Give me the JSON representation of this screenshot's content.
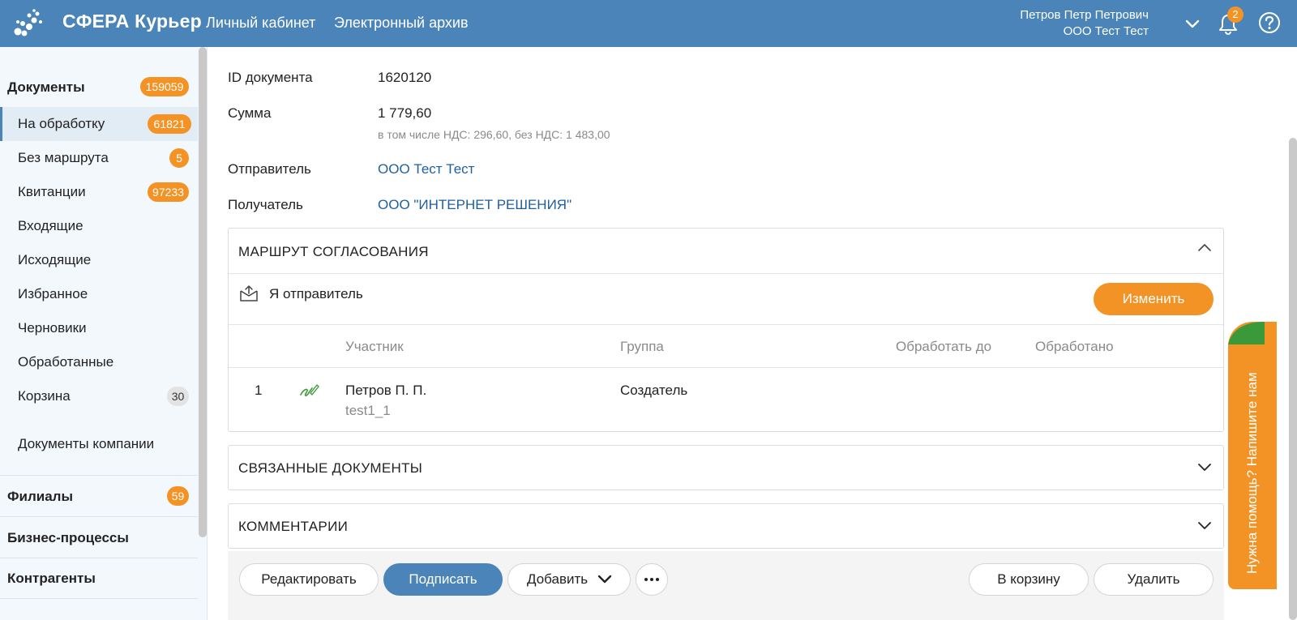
{
  "header": {
    "brand": "СФЕРА Курьер",
    "nav": [
      "Личный кабинет",
      "Электронный архив"
    ],
    "user_name": "Петров Петр Петрович",
    "user_org": "ООО Тест Тест",
    "notifications": "2",
    "bg_color": "#4a84b8"
  },
  "sidebar": {
    "documents_label": "Документы",
    "documents_count": "159059",
    "items": [
      {
        "label": "На обработку",
        "count": "61821"
      },
      {
        "label": "Без маршрута",
        "count": "5"
      },
      {
        "label": "Квитанции",
        "count": "97233"
      },
      {
        "label": "Входящие"
      },
      {
        "label": "Исходящие"
      },
      {
        "label": "Избранное"
      },
      {
        "label": "Черновики"
      },
      {
        "label": "Обработанные"
      },
      {
        "label": "Корзина",
        "count": "30"
      }
    ],
    "company_docs": "Документы компании",
    "branches_label": "Филиалы",
    "branches_count": "59",
    "business_label": "Бизнес-процессы",
    "contractors_label": "Контрагенты"
  },
  "document": {
    "id_label": "ID документа",
    "id_value": "1620120",
    "sum_label": "Сумма",
    "sum_value": "1 779,60",
    "sum_note": "в том числе НДС: 296,60, без НДС: 1 483,00",
    "sender_label": "Отправитель",
    "sender_value": "ООО Тест Тест",
    "recipient_label": "Получатель",
    "recipient_value": "ООО \"ИНТЕРНЕТ РЕШЕНИЯ\""
  },
  "route": {
    "title": "МАРШРУТ СОГЛАСОВАНИЯ",
    "role": "Я отправитель",
    "change_button": "Изменить",
    "columns": [
      "Участник",
      "Группа",
      "Обработать до",
      "Обработано"
    ],
    "rows": [
      {
        "num": "1",
        "participant": "Петров П. П.",
        "login": "test1_1",
        "group": "Создатель"
      }
    ]
  },
  "linked_docs_title": "СВЯЗАННЫЕ ДОКУМЕНТЫ",
  "comments_title": "КОММЕНТАРИИ",
  "actions": {
    "edit": "Редактировать",
    "sign": "Подписать",
    "add": "Добавить",
    "to_trash": "В корзину",
    "delete": "Удалить"
  },
  "help_tab": "Нужна помощь? Напишите нам",
  "accent_color": "#f39325"
}
